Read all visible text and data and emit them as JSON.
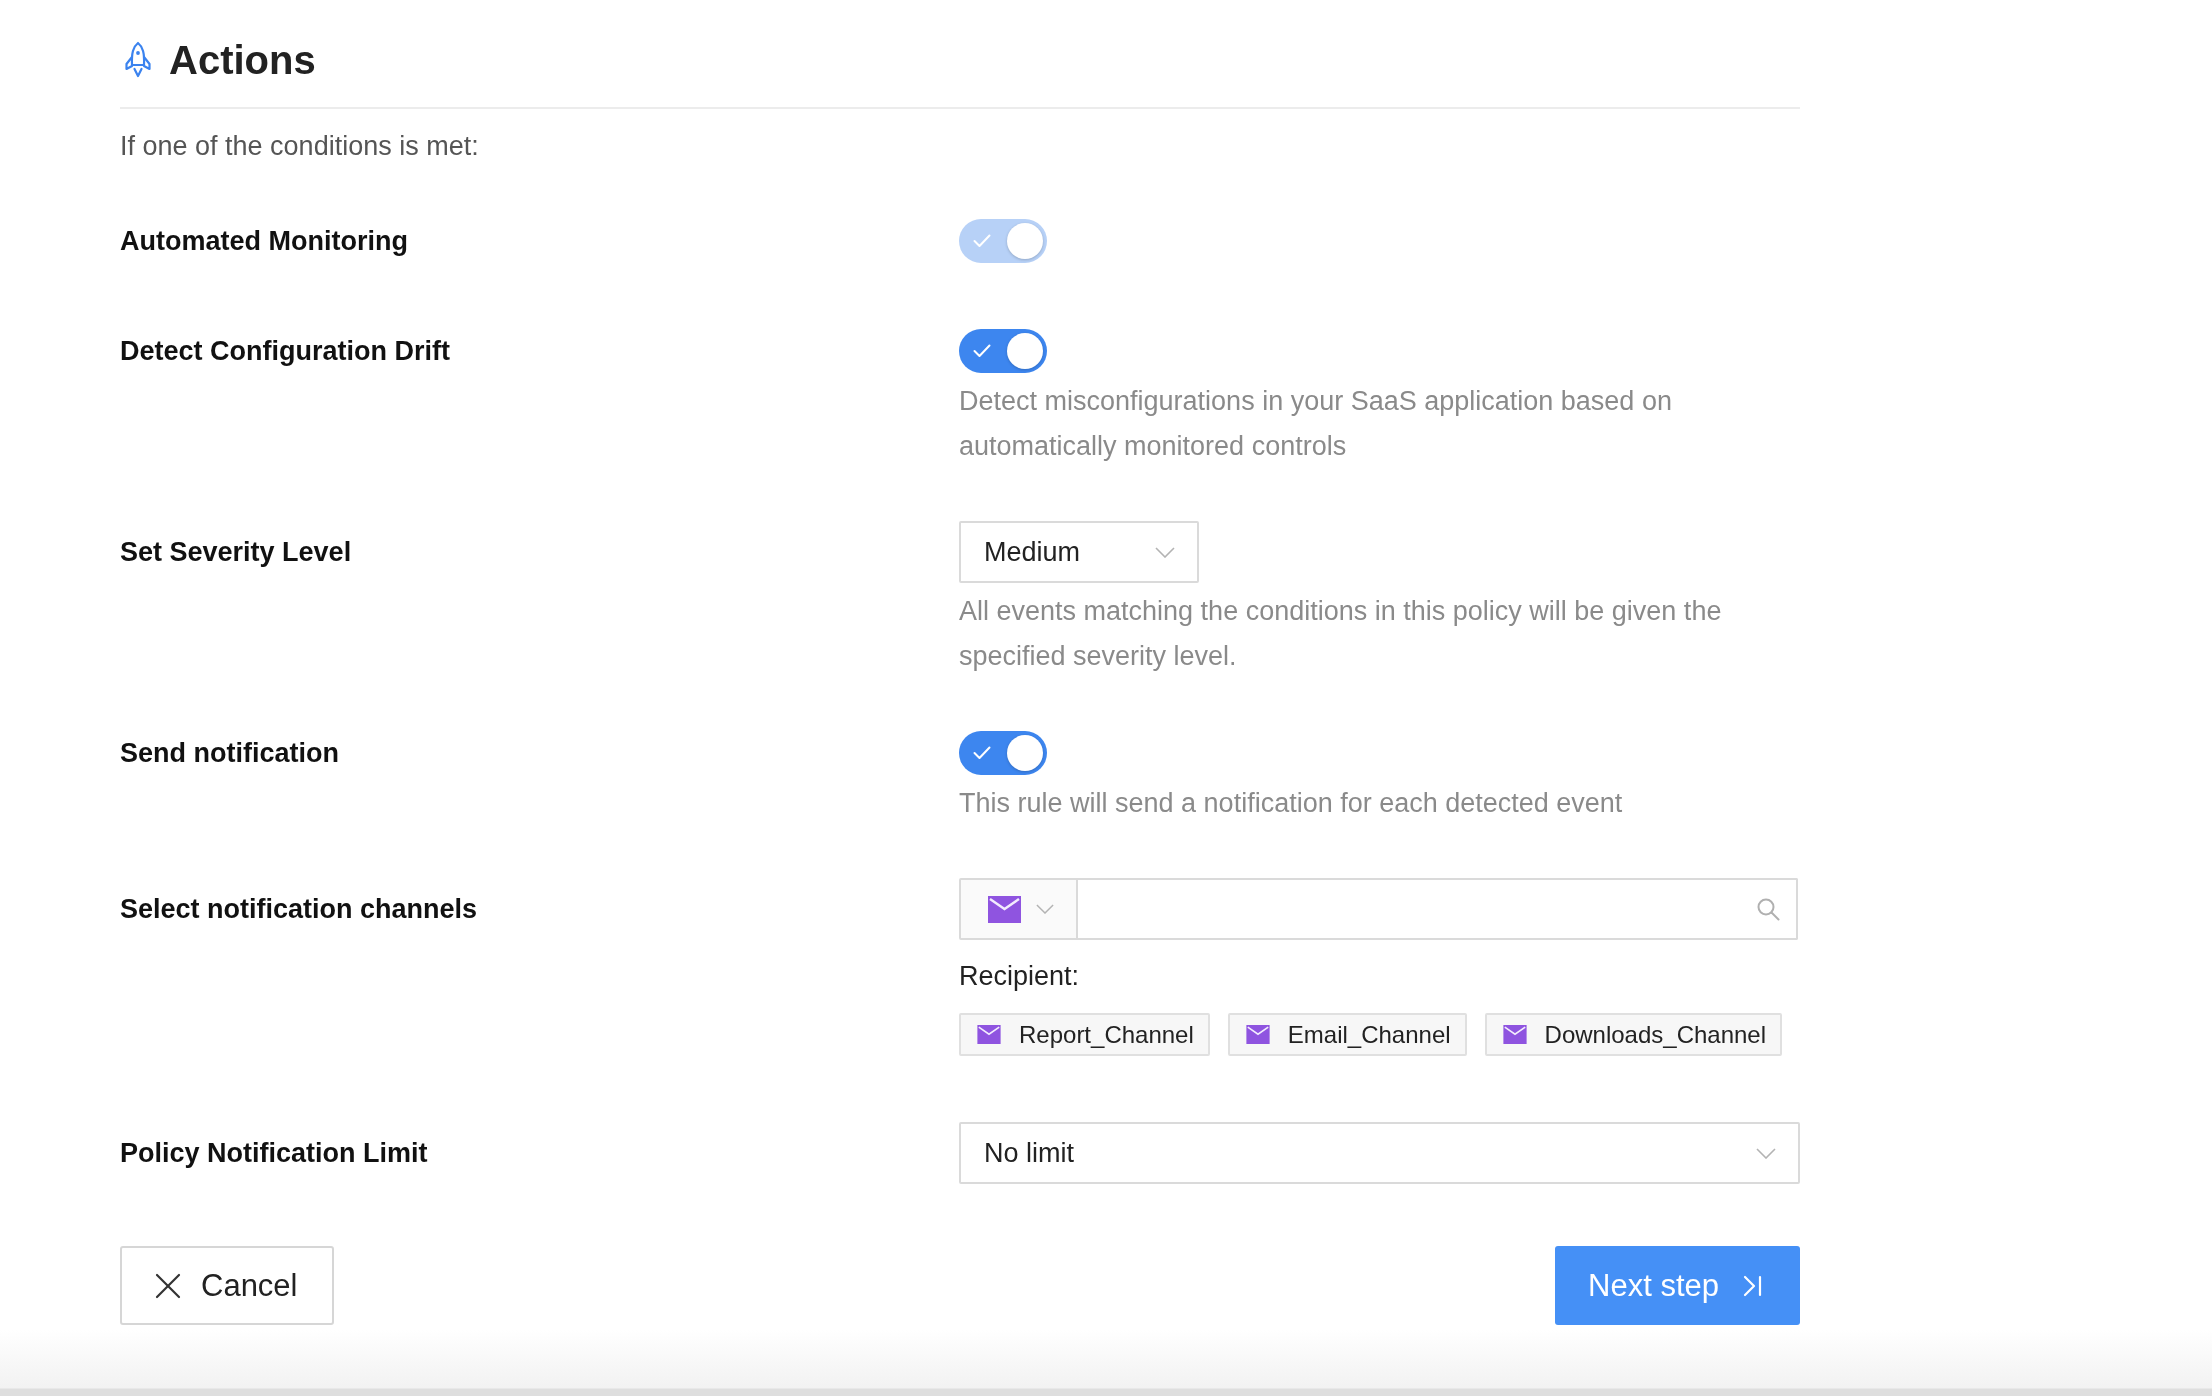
{
  "section": {
    "title": "Actions",
    "intro": "If one of the conditions is met:"
  },
  "settings": [
    {
      "kind": "toggle",
      "label": "Automated Monitoring",
      "checked": true,
      "disabled": true
    },
    {
      "kind": "toggle",
      "label": "Detect Configuration Drift",
      "checked": true,
      "disabled": false,
      "description": "Detect misconfigurations in your SaaS application based on automatically monitored controls"
    },
    {
      "kind": "dropdown",
      "label": "Set Severity Level",
      "value": "Medium",
      "description": "All events matching the conditions in this policy will be given the specified severity level."
    },
    {
      "kind": "toggle",
      "label": "Send notification",
      "checked": true,
      "disabled": false,
      "description": "This rule will send a notification for each detected event"
    },
    {
      "kind": "channels",
      "label": "Select notification channels",
      "recipient_label": "Recipient:",
      "recipients": [
        "Report_Channel",
        "Email_Channel",
        "Downloads_Channel"
      ]
    },
    {
      "kind": "select",
      "label": "Policy Notification Limit",
      "value": "No limit"
    }
  ],
  "actions": {
    "cancel": "Cancel",
    "next": "Next step"
  }
}
